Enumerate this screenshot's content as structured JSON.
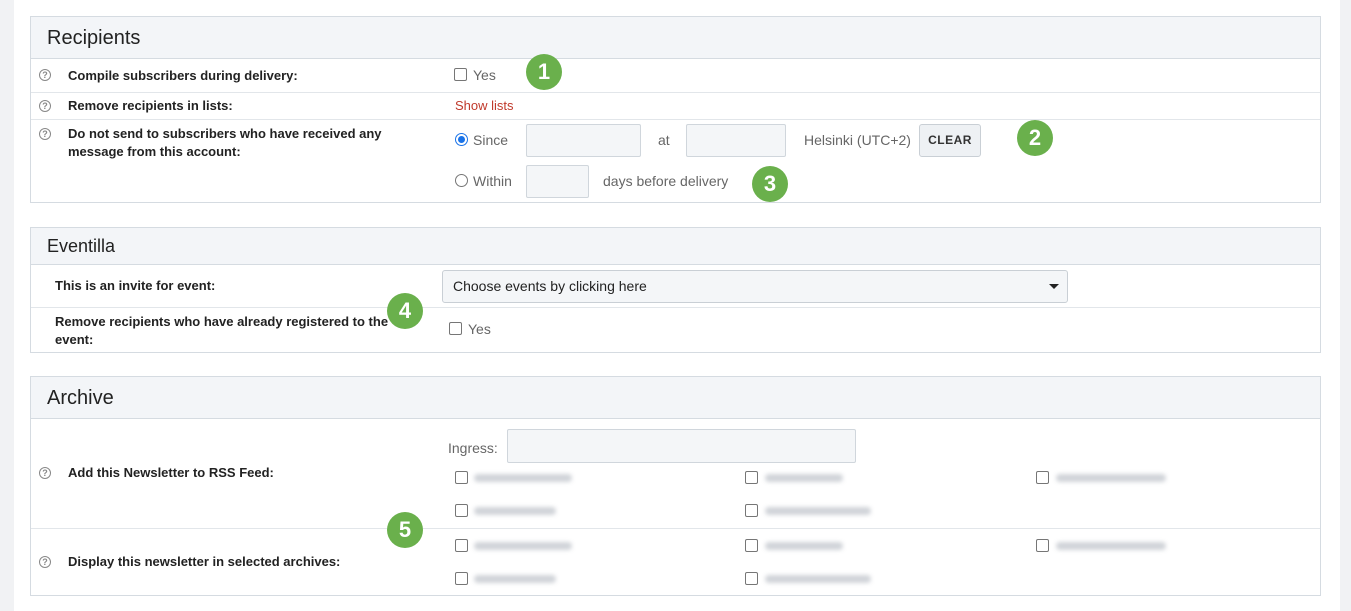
{
  "recipients": {
    "title": "Recipients",
    "help_icon": "?",
    "compile": {
      "label": "Compile subscribers during delivery:",
      "option": "Yes"
    },
    "remove_lists": {
      "label": "Remove recipients in lists:",
      "link": "Show lists"
    },
    "do_not_send": {
      "label_line1": "Do not send to subscribers who have received any",
      "label_line2": "message from this account:",
      "since_label": "Since",
      "at_label": "at",
      "timezone": "Helsinki (UTC+2)",
      "clear_button": "CLEAR",
      "within_label": "Within",
      "days_label": "days before delivery"
    }
  },
  "eventtilla": {
    "title": "Eventilla",
    "invite": {
      "label": "This is an invite for event:",
      "select_value": "Choose events by clicking here"
    },
    "remove_registered": {
      "label_line1": "Remove recipients who have already registered to the",
      "label_line2": "event:",
      "option": "Yes"
    }
  },
  "archive": {
    "title": "Archive",
    "rss": {
      "label": "Add this Newsletter to RSS Feed:",
      "ingress_label": "Ingress:"
    },
    "display": {
      "label": "Display this newsletter in selected archives:"
    }
  },
  "badges": [
    "1",
    "2",
    "3",
    "4",
    "5"
  ],
  "colors": {
    "accent_green": "#6ab04c",
    "link_red": "#c0392b",
    "radio_blue": "#1a73e8"
  }
}
